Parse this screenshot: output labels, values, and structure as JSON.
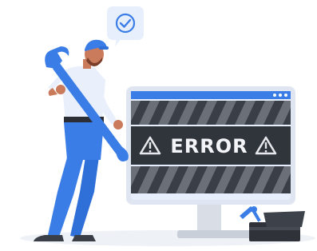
{
  "illustration": {
    "monitor": {
      "message": "ERROR"
    },
    "speech_bubble": {
      "icon": "checkmark-icon"
    },
    "warning_icons": [
      "warning-triangle-icon",
      "warning-triangle-icon"
    ],
    "colors": {
      "accent_blue": "#3b7de6",
      "dark_gray": "#3a3f47",
      "stripe_gray": "#5a5f66",
      "screen_bg": "#e7effc",
      "skin": "#c97b5b"
    }
  }
}
